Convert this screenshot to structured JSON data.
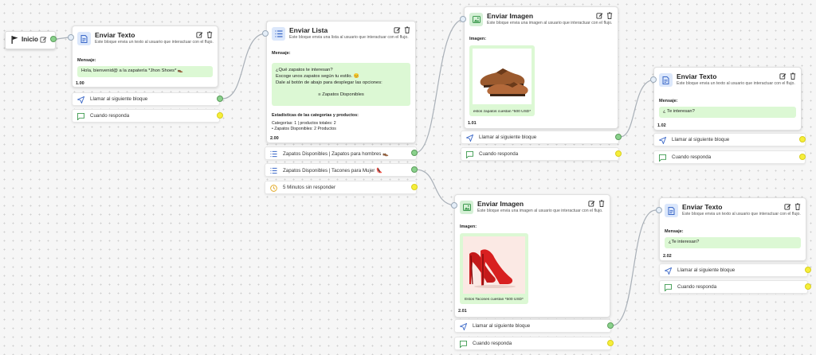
{
  "start": {
    "label": "Inicio"
  },
  "header_actions": {
    "edit": "edit-icon",
    "delete": "trash-icon"
  },
  "nodes": {
    "text1": {
      "title": "Enviar Texto",
      "desc": "Este bloque envia un texto al usuario que interactuar con el flujo.",
      "message_label": "Mensaje:",
      "message": "Hola, bienvenid@ a la zapatería *Jhon Shoes* 👞",
      "index": "1.00"
    },
    "list": {
      "title": "Enviar Lista",
      "desc": "Este bloque envia una lista al usuario que interactuar con el flujo.",
      "message_label": "Mensaje:",
      "message_lines": [
        "¿Qué zapatos te interesan?",
        "Escoge unos zapatos según tu estilo. 😊",
        "Dale al botón de abajo para desplegar las opciones:",
        "",
        "≡ Zapatos Disponibles"
      ],
      "stats_title": "Estadísticas de las categorías y productos:",
      "stats_lines": [
        "Categorías: 1 | productos totales: 2",
        "• Zapatos Disponibles: 2 Productos"
      ],
      "index": "2.00"
    },
    "image1": {
      "title": "Enviar Imagen",
      "desc": "Este bloque envia una imagen al usuario que interactuar con el flujo.",
      "image_label": "Imagen:",
      "caption": "estos zapatos cuestan *500 USD*",
      "index": "1.01"
    },
    "text2": {
      "title": "Enviar Texto",
      "desc": "Este bloque envia un texto al usuario que interactuar con el flujo.",
      "message_label": "Mensaje:",
      "message": "¿ Te interesan?",
      "index": "1.02"
    },
    "image2": {
      "title": "Enviar Imagen",
      "desc": "Este bloque envia una imagen al usuario que interactuar con el flujo.",
      "image_label": "Imagen:",
      "caption": "Estos Tacones cuestan *500 USD*",
      "index": "2.01"
    },
    "text3": {
      "title": "Enviar Texto",
      "desc": "Este bloque envia un texto al usuario que interactuar con el flujo.",
      "message_label": "Mensaje:",
      "message": "¿Te interesan?",
      "index": "2.02"
    }
  },
  "options": {
    "next": "Llamar al siguiente bloque",
    "reply": "Cuando responda",
    "list_item1": "Zapatos Disponibles | Zapatos para hombres 👞",
    "list_item2": "Zapatos Disponibles | Tacones para Mujer 👠",
    "timeout": "5 Minutos sin responder"
  },
  "colors": {
    "accent_blue": "#3a67c7",
    "accent_green": "#3d9a4f",
    "wire": "#a9b0b8",
    "msg_bg": "#dcf8d4",
    "dot_green": "#8ad18c",
    "dot_yellow": "#f6ee3a"
  }
}
